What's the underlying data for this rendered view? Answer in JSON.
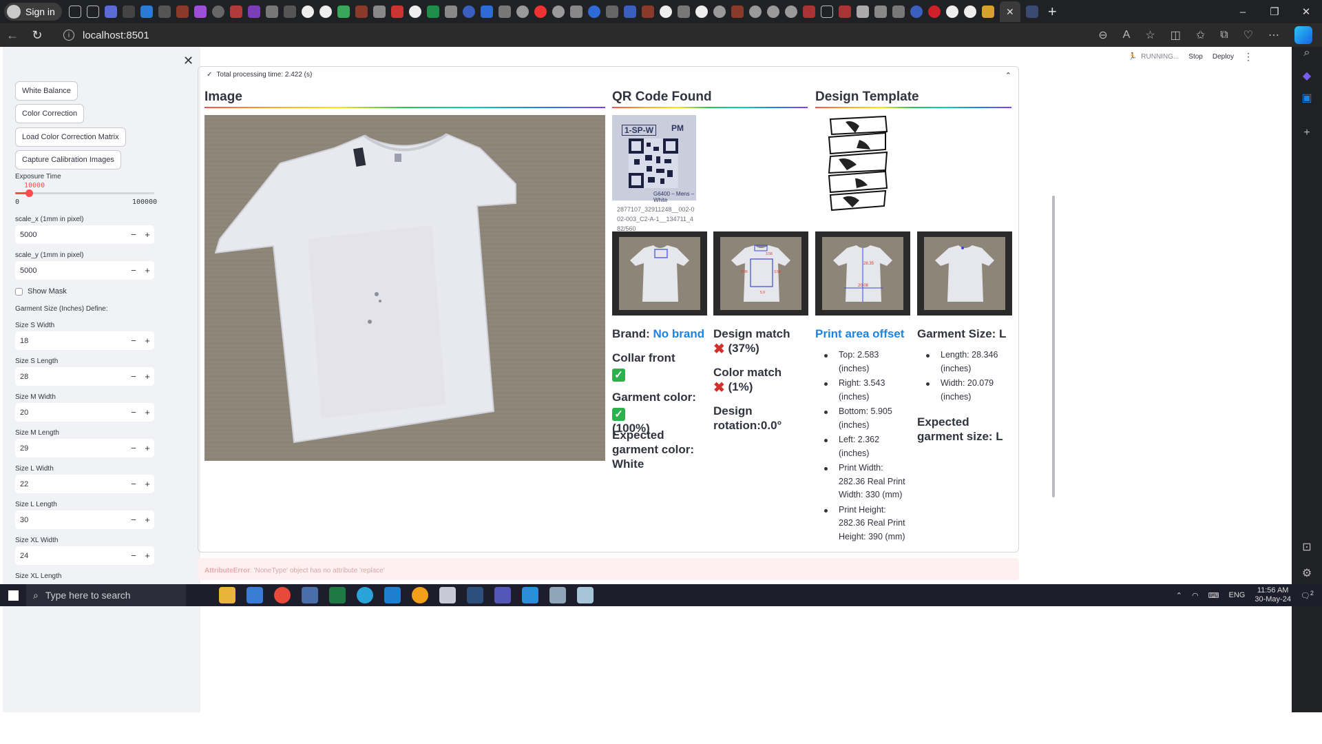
{
  "browser": {
    "signin_label": "Sign in",
    "url": "localhost:8501",
    "window_controls": [
      "–",
      "❐",
      "✕"
    ]
  },
  "sidebar": {
    "buttons": [
      "White Balance",
      "Color Correction",
      "Load Color Correction Matrix",
      "Capture Calibration Images"
    ],
    "exposure": {
      "label": "Exposure Time",
      "value": "10000",
      "min": "0",
      "max": "100000",
      "fraction": 0.1
    },
    "inputs": [
      {
        "label": "scale_x (1mm in pixel)",
        "value": "5000"
      },
      {
        "label": "scale_y (1mm in pixel)",
        "value": "5000"
      }
    ],
    "show_mask_label": "Show Mask",
    "garment_define_label": "Garment Size (Inches) Define:",
    "sizes": [
      {
        "label": "Size S Width",
        "value": "18"
      },
      {
        "label": "Size S Length",
        "value": "28"
      },
      {
        "label": "Size M Width",
        "value": "20"
      },
      {
        "label": "Size M Length",
        "value": "29"
      },
      {
        "label": "Size L Width",
        "value": "22"
      },
      {
        "label": "Size L Length",
        "value": "30"
      },
      {
        "label": "Size XL Width",
        "value": "24"
      }
    ],
    "last_label": "Size XL Length"
  },
  "header": {
    "running": "RUNNING...",
    "stop": "Stop",
    "deploy": "Deploy"
  },
  "results": {
    "processing_time": "Total processing time: 2.422 (s)",
    "image_heading": "Image",
    "qr_heading": "QR Code Found",
    "design_heading": "Design Template",
    "qr_caption": "2877107_32911248__002-002-003_C2-A-1__134711_482/560",
    "qr_label_top": "1-SP-W",
    "qr_label_pm": "PM",
    "qr_label_bottom": "G6400 – Mens – White",
    "thumb_labels": {
      "t2": [
        "3.58",
        "2.36",
        "3.54",
        "5.9"
      ],
      "t3": [
        "28.35",
        "20.08"
      ]
    },
    "brand_prefix": "Brand:",
    "brand_value": "No brand",
    "collar": "Collar front",
    "garment_color": "Garment color:",
    "garment_color_pct": "(100%)",
    "expected_color": "Expected garment color: White",
    "design_match": "Design match",
    "design_match_pct": "(37%)",
    "color_match": "Color match",
    "color_match_pct": "(1%)",
    "design_rotation": "Design rotation:0.0°",
    "offset_heading": "Print area offset",
    "offsets": [
      "Top: 2.583 (inches)",
      "Right: 3.543 (inches)",
      "Bottom: 5.905 (inches)",
      "Left: 2.362 (inches)",
      "Print Width: 282.36 Real Print Width: 330 (mm)",
      "Print Height: 282.36 Real Print Height: 390 (mm)"
    ],
    "garment_size": "Garment Size: L",
    "size_details": [
      "Length: 28.346 (inches)",
      "Width: 20.079 (inches)"
    ],
    "expected_size": "Expected garment size: L"
  },
  "error": {
    "type": "AttributeError",
    "message": ": 'NoneType' object has no attribute 'replace'"
  },
  "taskbar": {
    "search_placeholder": "Type here to search",
    "lang": "ENG",
    "time": "11:56 AM",
    "date": "30-May-24",
    "notif_count": "2"
  },
  "colors": {
    "accent": "#ff4b4b",
    "link": "#1c83e1",
    "ok": "#2bb24c",
    "bad": "#d0312d"
  }
}
